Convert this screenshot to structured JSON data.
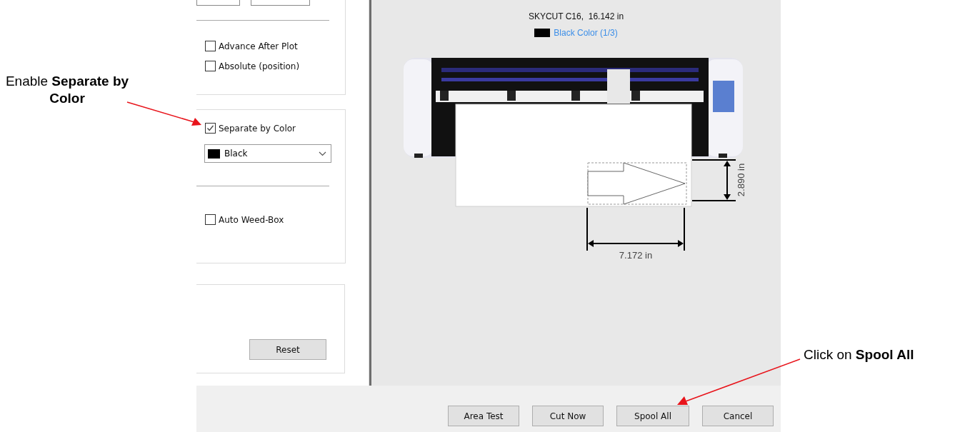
{
  "left_panel": {
    "options": [
      {
        "label": "Advance After Plot",
        "checked": false
      },
      {
        "label": "Absolute (position)",
        "checked": false
      }
    ],
    "separate_by_color": {
      "label": "Separate by Color",
      "checked": true
    },
    "color_select": {
      "value": "Black"
    },
    "weed_box": {
      "label": "Auto Weed-Box",
      "checked": false
    },
    "reset_button": "Reset"
  },
  "preview": {
    "machine": "SKYCUT C16,  16.142 in",
    "color_layer": "Black Color (1/3)",
    "height": "2.890 in",
    "width": "7.172 in"
  },
  "buttons": [
    "Area Test",
    "Cut Now",
    "Spool All",
    "Cancel"
  ],
  "annotations": [
    {
      "text": "Enable **Separate by Color**"
    },
    {
      "text": "Click on **Spool All**"
    }
  ]
}
